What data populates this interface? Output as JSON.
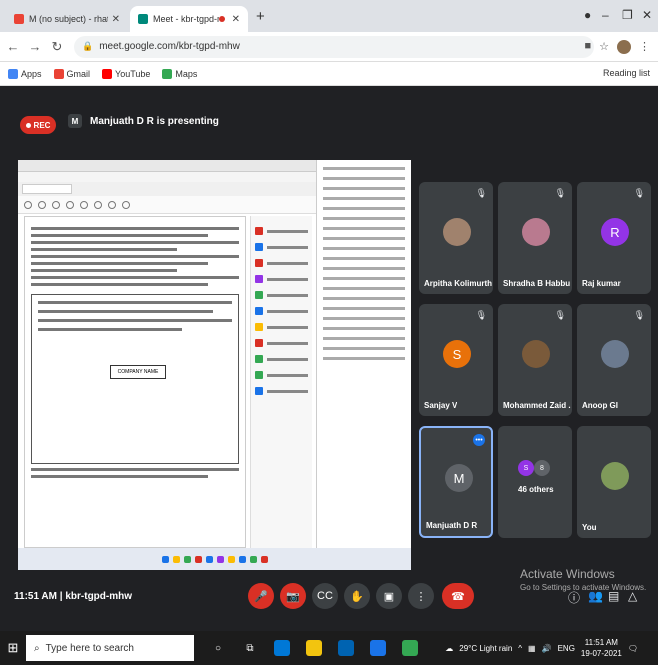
{
  "browser": {
    "tabs": [
      {
        "title": "M (no subject) - rhatianaghuv@G",
        "active": false
      },
      {
        "title": "Meet - kbr-tgpd-mhw",
        "active": true
      }
    ],
    "url": "meet.google.com/kbr-tgpd-mhw",
    "bookmarks": [
      "Apps",
      "Gmail",
      "YouTube",
      "Maps"
    ],
    "reading_list": "Reading list"
  },
  "meet": {
    "rec_label": "REC",
    "presenter_initial": "M",
    "presenting_text": "Manjuath D R is presenting",
    "meeting_time": "11:51 AM",
    "meeting_code": "kbr-tgpd-mhw",
    "shared_doc": {
      "company_box": "COMPANY NAME"
    },
    "participants": [
      {
        "name": "Arpitha Kolimurthy",
        "kind": "photo",
        "color": "#a0826d"
      },
      {
        "name": "Shradha B Habbu",
        "kind": "photo",
        "color": "#b97a8f"
      },
      {
        "name": "Raj kumar",
        "kind": "letter",
        "letter": "R",
        "color": "#9334e6"
      },
      {
        "name": "Sanjay V",
        "kind": "letter",
        "letter": "S",
        "color": "#e8710a"
      },
      {
        "name": "Mohammed Zaid ...",
        "kind": "photo",
        "color": "#7a5a3a"
      },
      {
        "name": "Anoop GI",
        "kind": "photo",
        "color": "#6b7a8f"
      },
      {
        "name": "Manjuath D R",
        "kind": "letter",
        "letter": "M",
        "color": "#5f6368"
      },
      {
        "name": "46 others",
        "kind": "others"
      },
      {
        "name": "You",
        "kind": "photo",
        "color": "#7f9a5a"
      }
    ],
    "watermark": {
      "line1": "Activate Windows",
      "line2": "Go to Settings to activate Windows."
    }
  },
  "taskbar": {
    "search_placeholder": "Type here to search",
    "weather": "29°C Light rain",
    "lang": "ENG",
    "time": "11:51 AM",
    "date": "19-07-2021"
  },
  "colors": {
    "red": "#d93025",
    "meet_bg": "#202124",
    "tile_bg": "#3c4043",
    "accent": "#1a73e8"
  }
}
